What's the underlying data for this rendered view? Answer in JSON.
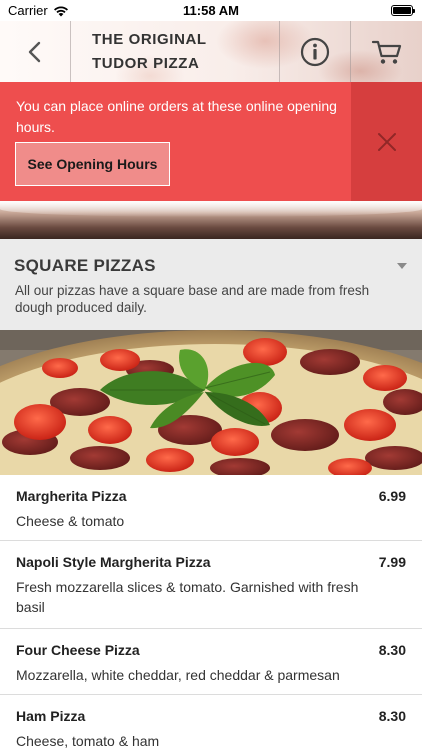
{
  "status_bar": {
    "carrier": "Carrier",
    "time": "11:58 AM"
  },
  "header": {
    "title": "THE ORIGINAL\nTUDOR PIZZA",
    "icons": {
      "back": "chevron-left-icon",
      "info": "info-circle-icon",
      "cart": "cart-icon"
    }
  },
  "banner": {
    "message": "You can place online orders at these online opening hours.",
    "button_label": "See Opening Hours",
    "close_icon": "close-icon",
    "color": "#ee4e4e"
  },
  "category": {
    "title": "SQUARE PIZZAS",
    "description": "All our pizzas have a square base and are made from fresh dough produced daily."
  },
  "menu_items": [
    {
      "name": "Margherita Pizza",
      "price": "6.99",
      "description": "Cheese & tomato"
    },
    {
      "name": "Napoli Style Margherita Pizza",
      "price": "7.99",
      "description": "Fresh mozzarella slices & tomato. Garnished with fresh basil"
    },
    {
      "name": "Four Cheese Pizza",
      "price": "8.30",
      "description": "Mozzarella, white cheddar, red cheddar & parmesan"
    },
    {
      "name": "Ham Pizza",
      "price": "8.30",
      "description": "Cheese, tomato & ham"
    }
  ]
}
